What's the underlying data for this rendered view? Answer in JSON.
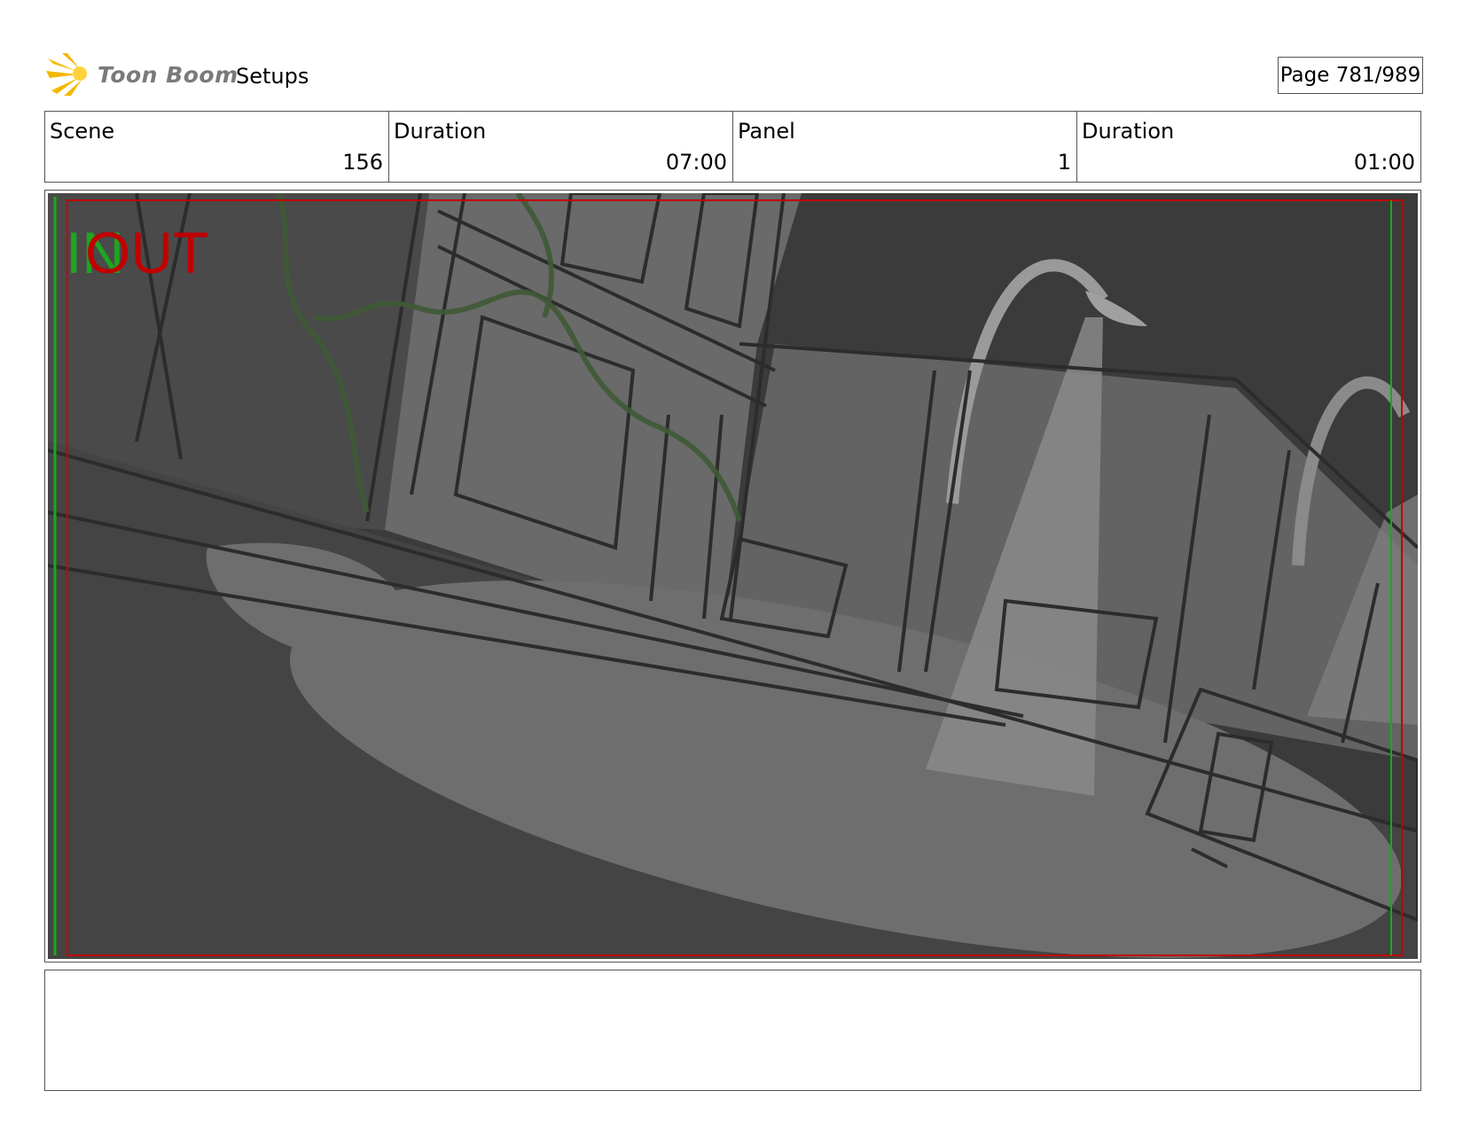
{
  "header": {
    "logo_text": "Toon Boom",
    "project_title": "Setups",
    "page_label": "Page 781/989"
  },
  "info": {
    "scene_label": "Scene",
    "scene_value": "156",
    "scene_duration_label": "Duration",
    "scene_duration_value": "07:00",
    "panel_label": "Panel",
    "panel_value": "1",
    "panel_duration_label": "Duration",
    "panel_duration_value": "01:00"
  },
  "panel": {
    "in_label": "IN",
    "out_label": "OUT"
  },
  "colors": {
    "in_marker": "#1fa51f",
    "out_marker": "#c00000",
    "sky": "#3a3a3a",
    "wall": "#6b6b6b",
    "light": "#8a8a8a"
  },
  "notes": {
    "text": ""
  }
}
